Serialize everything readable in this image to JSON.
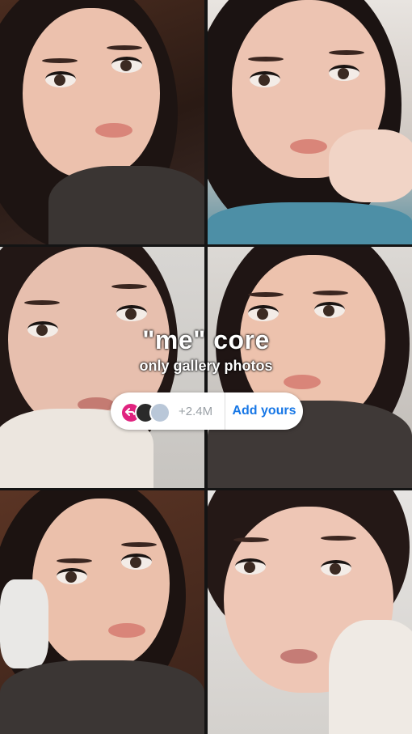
{
  "story": {
    "title": "\"me\" core",
    "subtitle": "only gallery photos"
  },
  "add_yours_sticker": {
    "participant_count": "+2.4M",
    "action_label": "Add yours",
    "avatars": [
      "reply-arrow-icon",
      "participant-avatar",
      "participant-avatar"
    ]
  },
  "colors": {
    "accent": "#1777e6",
    "avatar_pink": "#e0237f",
    "sticker_bg": "#ffffff"
  },
  "photos": [
    {
      "name": "selfie-1"
    },
    {
      "name": "selfie-2"
    },
    {
      "name": "selfie-3"
    },
    {
      "name": "selfie-4"
    },
    {
      "name": "selfie-5"
    },
    {
      "name": "selfie-6"
    }
  ]
}
